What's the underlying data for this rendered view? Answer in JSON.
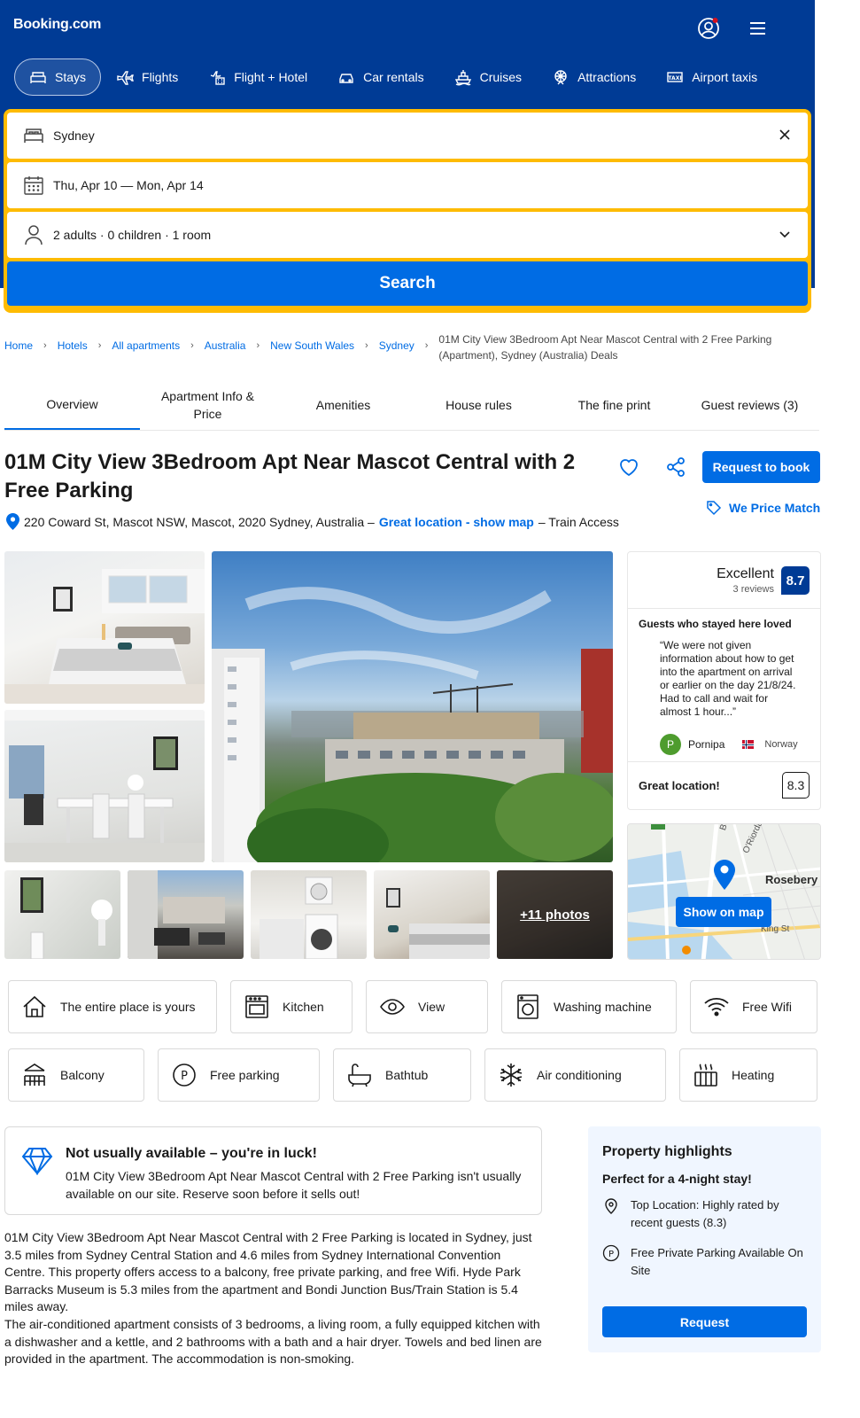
{
  "header": {
    "logo": "Booking.com",
    "account_icon": "account-icon",
    "menu_icon": "menu-icon",
    "nav": [
      {
        "label": "Stays",
        "icon": "bed-icon",
        "active": true
      },
      {
        "label": "Flights",
        "icon": "plane-icon"
      },
      {
        "label": "Flight + Hotel",
        "icon": "flight-hotel-icon"
      },
      {
        "label": "Car rentals",
        "icon": "car-icon"
      },
      {
        "label": "Cruises",
        "icon": "ship-icon"
      },
      {
        "label": "Attractions",
        "icon": "attractions-icon"
      },
      {
        "label": "Airport taxis",
        "icon": "taxi-icon"
      }
    ]
  },
  "search": {
    "destination": "Sydney",
    "dates": "Thu, Apr 10 — Mon, Apr 14",
    "guests": "2 adults · 0 children · 1 room",
    "button": "Search"
  },
  "breadcrumb": {
    "items": [
      "Home",
      "Hotels",
      "All apartments",
      "Australia",
      "New South Wales",
      "Sydney"
    ],
    "current": "01M City View 3Bedroom Apt Near Mascot Central with 2 Free Parking (Apartment), Sydney (Australia) Deals"
  },
  "tabs": [
    "Overview",
    "Apartment Info & Price",
    "Amenities",
    "House rules",
    "The fine print",
    "Guest reviews (3)"
  ],
  "property": {
    "title": "01M City View 3Bedroom Apt Near Mascot Central with 2 Free Parking",
    "address": "220 Coward St, Mascot NSW, Mascot, 2020 Sydney, Australia –",
    "location_link": "Great location - show map",
    "address_suffix": "– Train Access",
    "request_to_book": "Request to book",
    "price_match": "We Price Match",
    "more_photos": "+11 photos"
  },
  "review": {
    "word": "Excellent",
    "count": "3 reviews",
    "score": "8.7",
    "loved_heading": "Guests who stayed here loved",
    "quote": "“We were not given information about how to get into the apartment on arrival or earlier on the day 21/8/24. Had to call and wait for almost 1 hour...”",
    "author_initial": "P",
    "author": "Pornipa",
    "country": "Norway",
    "location_label": "Great location!",
    "location_score": "8.3"
  },
  "map": {
    "button": "Show on map",
    "area_label": "Rosebery",
    "streets": [
      "Bourke Rd",
      "O'Riordan",
      "King St"
    ]
  },
  "facilities": [
    {
      "label": "The entire place is yours",
      "icon": "house-icon"
    },
    {
      "label": "Kitchen",
      "icon": "kitchen-icon"
    },
    {
      "label": "View",
      "icon": "eye-icon"
    },
    {
      "label": "Washing machine",
      "icon": "washing-machine-icon"
    },
    {
      "label": "Free Wifi",
      "icon": "wifi-icon"
    },
    {
      "label": "Balcony",
      "icon": "balcony-icon"
    },
    {
      "label": "Free parking",
      "icon": "parking-icon"
    },
    {
      "label": "Bathtub",
      "icon": "bathtub-icon"
    },
    {
      "label": "Air conditioning",
      "icon": "snowflake-icon"
    },
    {
      "label": "Heating",
      "icon": "heating-icon"
    }
  ],
  "luck": {
    "title": "Not usually available – you're in luck!",
    "body": "01M City View 3Bedroom Apt Near Mascot Central with 2 Free Parking isn't usually available on our site. Reserve soon before it sells out!"
  },
  "description": [
    "01M City View 3Bedroom Apt Near Mascot Central with 2 Free Parking is located in Sydney, just 3.5 miles from Sydney Central Station and 4.6 miles from Sydney International Convention Centre. This property offers access to a balcony, free private parking, and free Wifi. Hyde Park Barracks Museum is 5.3 miles from the apartment and Bondi Junction Bus/Train Station is 5.4 miles away.",
    "The air-conditioned apartment consists of 3 bedrooms, a living room, a fully equipped kitchen with a dishwasher and a kettle, and 2 bathrooms with a bath and a hair dryer. Towels and bed linen are provided in the apartment. The accommodation is non-smoking."
  ],
  "highlights": {
    "title": "Property highlights",
    "subtitle": "Perfect for a 4-night stay!",
    "items": [
      {
        "text": "Top Location: Highly rated by recent guests (8.3)",
        "icon": "location-pin-icon"
      },
      {
        "text": "Free Private Parking Available On Site",
        "icon": "parking-icon"
      }
    ],
    "button": "Request"
  },
  "colors": {
    "brand_blue": "#003b95",
    "action_blue": "#006ce4",
    "search_yellow": "#febb02",
    "highlight_bg": "#f0f6ff"
  }
}
